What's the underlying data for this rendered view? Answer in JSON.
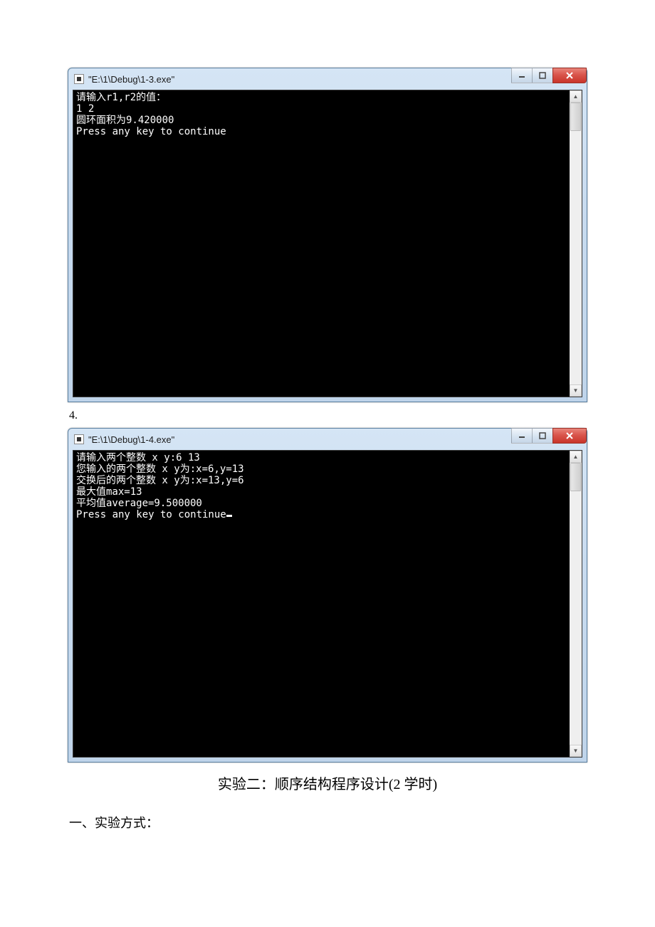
{
  "window1": {
    "title": "\"E:\\1\\Debug\\1-3.exe\"",
    "lines": [
      "请输入r1,r2的值：",
      "1 2",
      "圆环面积为9.420000",
      "Press any key to continue"
    ]
  },
  "item_number": "4.",
  "window2": {
    "title": "\"E:\\1\\Debug\\1-4.exe\"",
    "lines": [
      "请输入两个整数 x y:6 13",
      "您输入的两个整数 x y为:x=6,y=13",
      "交换后的两个整数 x y为:x=13,y=6",
      "最大值max=13",
      "平均值average=9.500000",
      "Press any key to continue"
    ]
  },
  "heading": "实验二：顺序结构程序设计(2 学时)",
  "subheading": "一、实验方式："
}
